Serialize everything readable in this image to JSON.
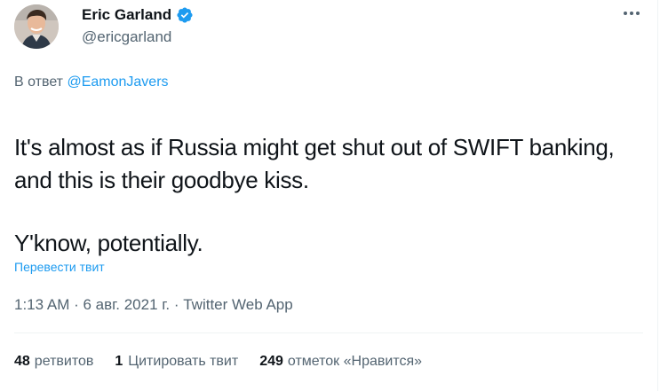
{
  "author": {
    "name": "Eric Garland",
    "handle": "@ericgarland",
    "verified": true
  },
  "reply": {
    "prefix": "В ответ",
    "mention": "@EamonJavers"
  },
  "tweet": {
    "line1": "It's almost as if Russia might get shut out of SWIFT banking, and this is their goodbye kiss.",
    "line2": "Y'know, potentially."
  },
  "translate_label": "Перевести твит",
  "meta": {
    "time": "1:13 AM",
    "sep1": " · ",
    "date": "6 авг. 2021 г.",
    "sep2": " · ",
    "source": "Twitter Web App"
  },
  "stats": {
    "retweets_count": "48",
    "retweets_label": "ретвитов",
    "quotes_count": "1",
    "quotes_label": "Цитировать твит",
    "likes_count": "249",
    "likes_label": "отметок «Нравится»"
  },
  "colors": {
    "accent": "#1d9bf0",
    "text": "#0f1419",
    "secondary": "#536471",
    "divider": "#eff3f4"
  }
}
